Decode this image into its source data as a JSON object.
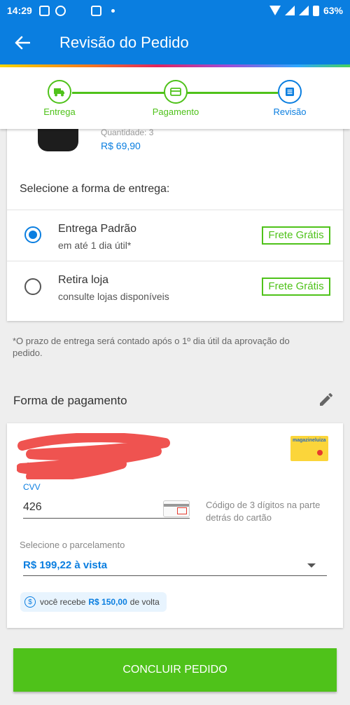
{
  "status_bar": {
    "time": "14:29",
    "battery": "63%"
  },
  "app_bar": {
    "title": "Revisão do Pedido"
  },
  "stepper": {
    "steps": [
      {
        "label": "Entrega",
        "state": "done"
      },
      {
        "label": "Pagamento",
        "state": "done"
      },
      {
        "label": "Revisão",
        "state": "current"
      }
    ]
  },
  "product": {
    "quantity": "Quantidade: 3",
    "price": "R$ 69,90"
  },
  "delivery": {
    "heading": "Selecione a forma de entrega:",
    "options": [
      {
        "title": "Entrega Padrão",
        "subtitle": "em até 1 dia útil*",
        "badge": "Frete Grátis",
        "selected": true
      },
      {
        "title": "Retira loja",
        "subtitle": "consulte lojas disponíveis",
        "badge": "Frete Grátis",
        "selected": false
      }
    ],
    "note": "*O prazo de entrega será contado após o 1º dia útil da aprovação do pedido."
  },
  "payment": {
    "heading": "Forma de pagamento",
    "card_number_partial": "c",
    "validity_partial": "alidade: 1  2027",
    "card_logo_text": "magazineluiza",
    "cvv_label": "CVV",
    "cvv_value": "426",
    "cvv_help": "Código de 3 dígitos na parte detrás do cartão",
    "installment_label": "Selecione o parcelamento",
    "installment_value": "R$ 199,22 à vista",
    "cashback_prefix": "você recebe",
    "cashback_amount": "R$ 150,00",
    "cashback_suffix": "de volta"
  },
  "cta": {
    "label": "CONCLUIR PEDIDO"
  },
  "colors": {
    "primary_blue": "#0a7ee0",
    "success_green": "#4fc21a",
    "redaction_red": "#ef5350"
  }
}
